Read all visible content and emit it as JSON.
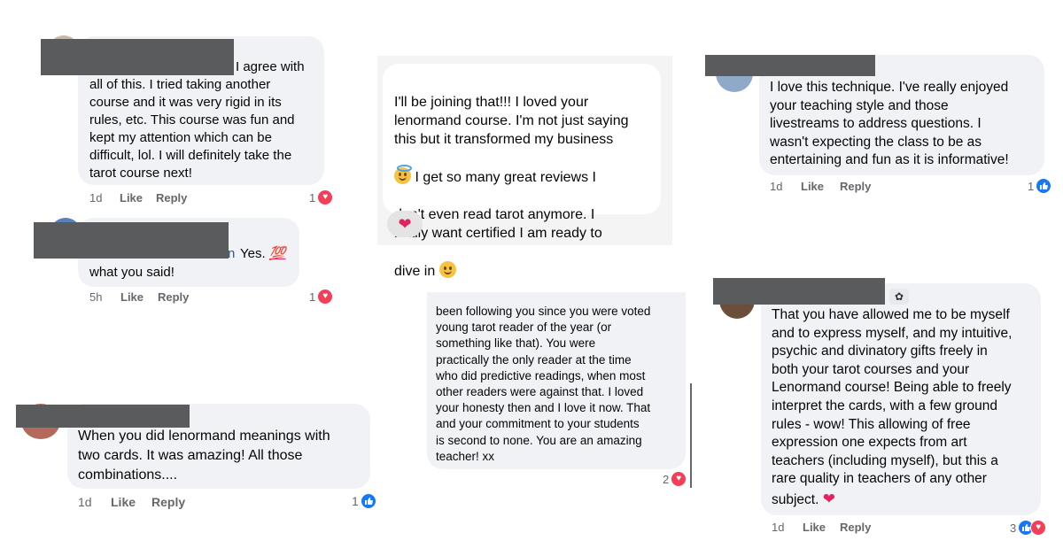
{
  "comments": [
    {
      "id": "c1",
      "text": "I agree with\nall of this. I tried taking another\ncourse and it was very rigid in its\nrules, etc. This course was fun and\nkept my attention which can be\ndifficult, lol. I will definitely take the\ntarot course next!",
      "time": "1d",
      "like": "Like",
      "reply": "Reply",
      "reactions": "1",
      "reaction_type": "heart"
    },
    {
      "id": "c2",
      "name_tail": "n",
      "text_line1": "Yes. ",
      "emoji": "💯",
      "text_line2": "what you said!",
      "time": "5h",
      "like": "Like",
      "reply": "Reply",
      "reactions": "1",
      "reaction_type": "heart"
    },
    {
      "id": "c3",
      "text": "When you did lenormand meanings with\ntwo cards. It was amazing! All those\ncombinations....",
      "time": "1d",
      "like": "Like",
      "reply": "Reply",
      "reactions": "1",
      "reaction_type": "like"
    },
    {
      "id": "c4",
      "text_part1": "I'll be joining that!!! I loved your\nlenormand course. I'm not just saying\nthis but it transformed my business",
      "text_part2": "I get so many great reviews I",
      "text_part3": "don't even read tarot anymore. I\nreally want certified I am ready to",
      "text_part4": "dive in",
      "reaction_emoji": "❤️"
    },
    {
      "id": "c5",
      "text": "been following you since you were voted\nyoung tarot reader of the year (or\nsomething like that).  You were\npractically the only reader at the time\nwho did predictive readings, when most\nother readers were against that.  I loved\nyour honesty then and I love it now.  That\nand your commitment to your students\nis second to none.  You are an amazing\nteacher!  xx",
      "reactions": "2",
      "reaction_type": "heart"
    },
    {
      "id": "c6",
      "text": "I love this technique. I've really enjoyed\nyour teaching style and those\nlivestreams to address questions. I\nwasn't expecting the class to be as\nentertaining and fun as it is informative!",
      "time": "1d",
      "like": "Like",
      "reply": "Reply",
      "reactions": "1",
      "reaction_type": "like"
    },
    {
      "id": "c7",
      "text": "That you have allowed me to be myself\nand to express myself, and my intuitive,\npsychic and divinatory gifts freely in\nboth your tarot courses and your\nLenormand course! Being able to freely\ninterpret the cards, with a few ground\nrules - wow! This allowing of free\nexpression one expects from art\nteachers (including myself), but this a\nrare quality in teachers of any other",
      "last_line": "subject.",
      "time": "1d",
      "like": "Like",
      "reply": "Reply",
      "reactions": "3",
      "reaction_type": "like-heart"
    }
  ]
}
